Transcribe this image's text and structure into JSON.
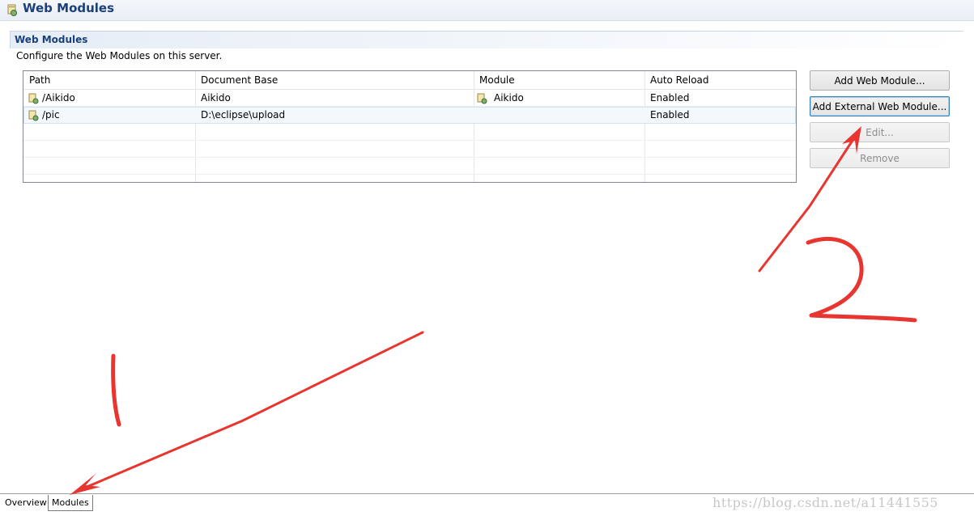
{
  "header": {
    "title": "Web Modules",
    "icon": "server-module-icon"
  },
  "section": {
    "title": "Web Modules",
    "description": "Configure the Web Modules on this server."
  },
  "table": {
    "columns": [
      "Path",
      "Document Base",
      "Module",
      "Auto Reload"
    ],
    "rows": [
      {
        "path": "/Aikido",
        "doc_base": "Aikido",
        "module": "Aikido",
        "auto_reload": "Enabled"
      },
      {
        "path": "/pic",
        "doc_base": "D:\\eclipse\\upload",
        "module": "",
        "auto_reload": "Enabled"
      }
    ]
  },
  "buttons": {
    "add": "Add Web Module...",
    "add_external": "Add External Web Module...",
    "edit": "Edit...",
    "remove": "Remove"
  },
  "tabs": {
    "overview": "Overview",
    "modules": "Modules"
  },
  "annotations": {
    "label_1": "1",
    "label_2": "2",
    "color": "#e8352f"
  },
  "watermark": "https://blog.csdn.net/a11441555"
}
